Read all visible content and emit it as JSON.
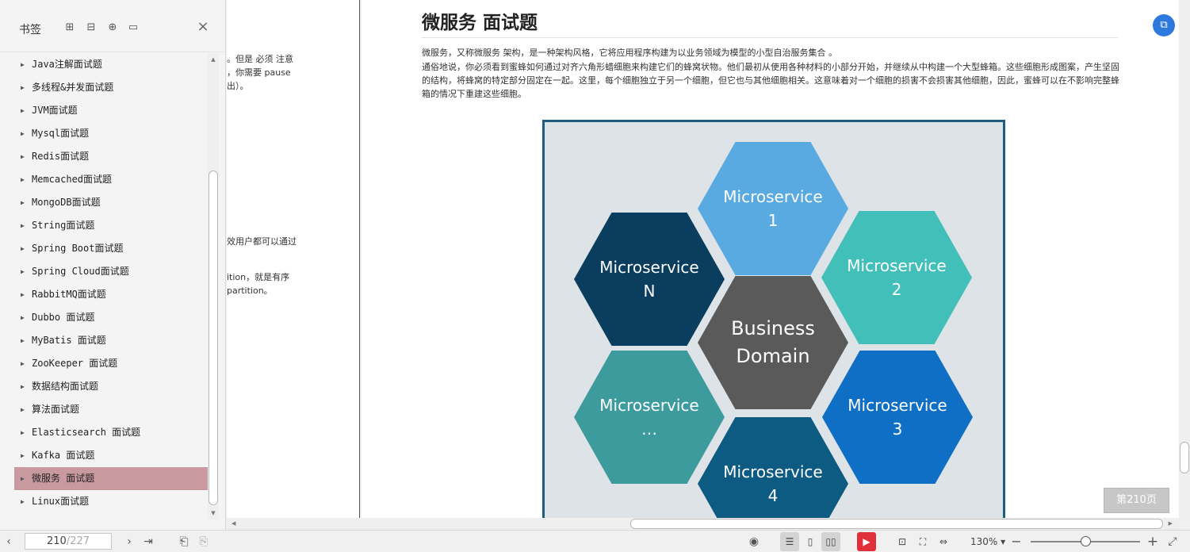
{
  "sidebar": {
    "title": "书签",
    "tool_icons": [
      "expand-all-icon",
      "collapse-all-icon",
      "add-bookmark-icon",
      "bookmark-options-icon"
    ],
    "items": [
      {
        "label": "Java注解面试题"
      },
      {
        "label": "多线程&并发面试题"
      },
      {
        "label": "JVM面试题"
      },
      {
        "label": "Mysql面试题"
      },
      {
        "label": "Redis面试题"
      },
      {
        "label": "Memcached面试题"
      },
      {
        "label": "MongoDB面试题"
      },
      {
        "label": "String面试题"
      },
      {
        "label": "Spring Boot面试题"
      },
      {
        "label": "Spring Cloud面试题"
      },
      {
        "label": "RabbitMQ面试题"
      },
      {
        "label": "Dubbo 面试题"
      },
      {
        "label": "MyBatis 面试题"
      },
      {
        "label": "ZooKeeper 面试题"
      },
      {
        "label": "数据结构面试题"
      },
      {
        "label": "算法面试题"
      },
      {
        "label": "Elasticsearch 面试题"
      },
      {
        "label": "Kafka 面试题"
      },
      {
        "label": "微服务 面试题",
        "selected": true
      },
      {
        "label": "Linux面试题"
      }
    ]
  },
  "prev_page_fragments": [
    "。但是 必须 注意",
    "，你需要 pause",
    "出）。",
    "效用户都可以通过",
    "ition，就是有序",
    "partition。"
  ],
  "page": {
    "heading": "微服务 面试题",
    "para1": "微服务，又称微服务 架构，是一种架构风格，它将应用程序构建为以业务领域为模型的小型自治服务集合 。",
    "para2": "通俗地说，你必须看到蜜蜂如何通过对齐六角形蜡细胞来构建它们的蜂窝状物。他们最初从使用各种材料的小部分开始，并继续从中构建一个大型蜂箱。这些细胞形成图案，产生坚固的结构，将蜂窝的特定部分固定在一起。这里，每个细胞独立于另一个细胞，但它也与其他细胞相关。这意味着对一个细胞的损害不会损害其他细胞，因此，蜜蜂可以在不影响完整蜂箱的情况下重建这些细胞。"
  },
  "figure": {
    "center": "Business\nDomain",
    "hexes": {
      "ms1": "Microservice\n1",
      "ms2": "Microservice\n2",
      "ms3": "Microservice\n3",
      "ms4": "Microservice\n4",
      "msdots": "Microservice\n…",
      "msn": "Microservice\nN"
    },
    "colors": {
      "center": "#5a5a5a",
      "ms1": "#5aaae2",
      "ms2": "#41bfb8",
      "ms3": "#0e6fc4",
      "ms4": "#0d5a82",
      "msdots": "#3d9b9e",
      "msn": "#0b3e5e"
    }
  },
  "page_badge": "第210页",
  "statusbar": {
    "current_page": "210",
    "total_pages": "/227",
    "zoom": "130%",
    "zoom_fraction": 0.5
  }
}
